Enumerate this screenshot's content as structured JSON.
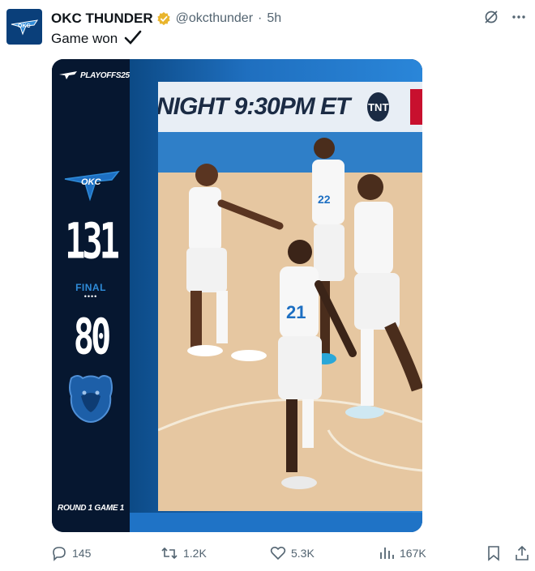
{
  "post": {
    "author_name": "OKC THUNDER",
    "handle": "@okcthunder",
    "separator": "·",
    "time": "5h",
    "text": "Game won",
    "text_icon": "check-mark-icon"
  },
  "media": {
    "playoffs_badge": "PLAYOFFS25",
    "home_score": "131",
    "status": "FINAL",
    "status_dots": "••••",
    "away_score": "80",
    "round_label": "ROUND 1 GAME 1",
    "banner_text": "NIGHT 9:30PM ET",
    "banner_logo": "TNT",
    "jersey_numbers": [
      "21",
      "22"
    ]
  },
  "actions": {
    "replies": "145",
    "reposts": "1.2K",
    "likes": "5.3K",
    "views": "167K"
  },
  "colors": {
    "brand_blue": "#0a3f7a",
    "sidebar_navy": "#061730",
    "accent_blue": "#2f8bd8",
    "verified_gold": "#e9b52d",
    "muted_text": "#536471"
  }
}
